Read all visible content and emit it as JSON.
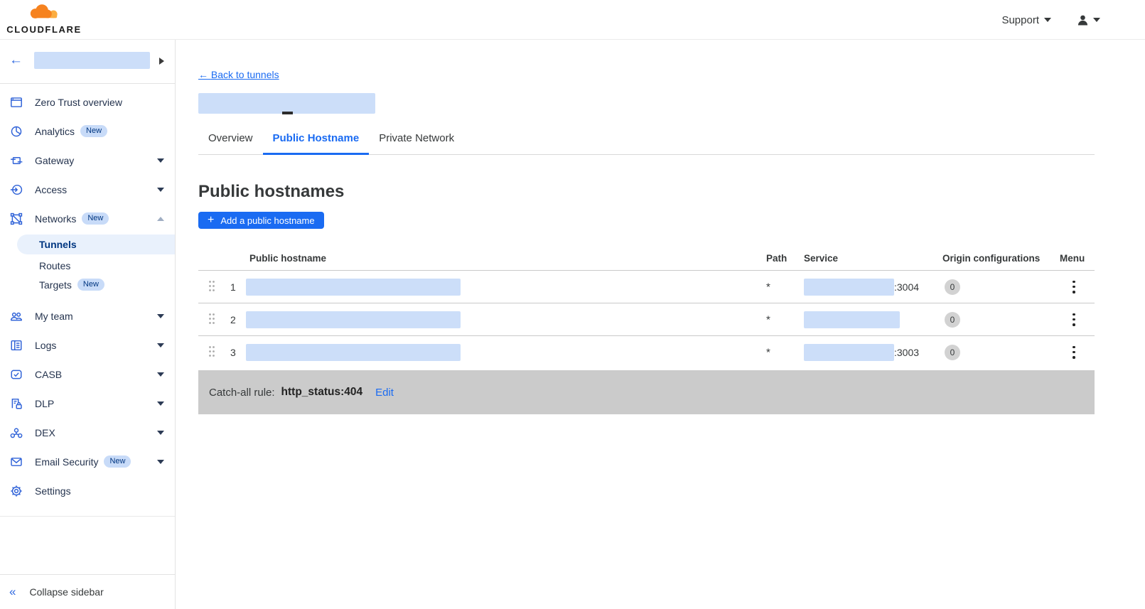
{
  "colors": {
    "accent_blue": "#1a6bf2",
    "icon_blue": "#2f62d8",
    "badge_bg": "#c8dbf8",
    "badge_text": "#003681",
    "redaction_blue": "#ccdef9",
    "selected_item_bg": "#e9f1fc",
    "catchall_bg": "#cbcbcb",
    "text_dark": "#36393a",
    "logo_orange": "#f6821f",
    "logo_light_orange": "#fbad41"
  },
  "topbar": {
    "logo_text": "CLOUDFLARE",
    "support_label": "Support"
  },
  "sidebar": {
    "items": [
      {
        "label": "Zero Trust overview"
      },
      {
        "label": "Analytics",
        "badge": "New"
      },
      {
        "label": "Gateway"
      },
      {
        "label": "Access"
      },
      {
        "label": "Networks",
        "badge": "New"
      },
      {
        "label": "My team"
      },
      {
        "label": "Logs"
      },
      {
        "label": "CASB"
      },
      {
        "label": "DLP"
      },
      {
        "label": "DEX"
      },
      {
        "label": "Email Security",
        "badge": "New"
      },
      {
        "label": "Settings"
      }
    ],
    "subitems": {
      "tunnels": "Tunnels",
      "routes": "Routes",
      "targets": "Targets",
      "targets_badge": "New"
    },
    "collapse": {
      "icon": "«",
      "label": "Collapse sidebar"
    }
  },
  "main": {
    "back": {
      "arrow": "←",
      "label": "Back to tunnels"
    },
    "tabs": {
      "overview": "Overview",
      "public_hostname": "Public Hostname",
      "private_network": "Private Network"
    },
    "heading": "Public hostnames",
    "add_button": {
      "icon": "+",
      "label": "Add a public hostname"
    },
    "table": {
      "headers": {
        "hostname": "Public hostname",
        "path": "Path",
        "service": "Service",
        "origin": "Origin configurations",
        "menu": "Menu"
      },
      "rows": [
        {
          "num": "1",
          "path": "*",
          "service_suffix": ":3004",
          "origin_count": "0"
        },
        {
          "num": "2",
          "path": "*",
          "service_suffix": "",
          "origin_count": "0"
        },
        {
          "num": "3",
          "path": "*",
          "service_suffix": ":3003",
          "origin_count": "0"
        }
      ]
    },
    "catch_all": {
      "label": "Catch-all rule:",
      "value": "http_status:404",
      "edit_label": "Edit"
    }
  }
}
